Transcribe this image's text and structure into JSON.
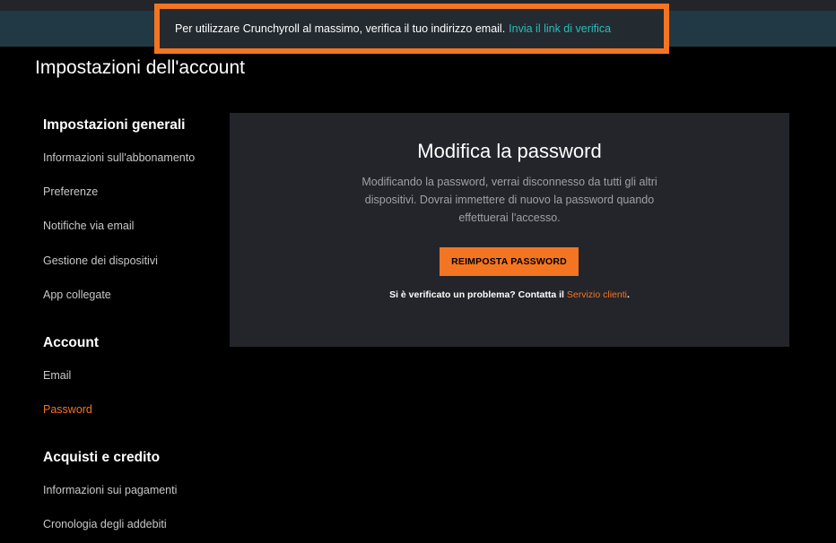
{
  "banner": {
    "message": "Per utilizzare Crunchyroll al massimo, verifica il tuo indirizzo email.",
    "link": "Invia il link di verifica"
  },
  "page_title": "Impostazioni dell'account",
  "sidebar": {
    "sections": [
      {
        "title": "Impostazioni generali",
        "items": [
          "Informazioni sull'abbonamento",
          "Preferenze",
          "Notifiche via email",
          "Gestione dei dispositivi",
          "App collegate"
        ]
      },
      {
        "title": "Account",
        "items": [
          "Email",
          "Password"
        ]
      },
      {
        "title": "Acquisti e credito",
        "items": [
          "Informazioni sui pagamenti",
          "Cronologia degli addebiti"
        ]
      }
    ],
    "active_item": "Password"
  },
  "card": {
    "title": "Modifica la password",
    "description": "Modificando la password, verrai disconnesso da tutti gli altri dispositivi. Dovrai immettere di nuovo la password quando effettuerai l'accesso.",
    "button_label": "REIMPOSTA PASSWORD",
    "problem_text": "Si è verificato un problema? Contatta il",
    "problem_link": "Servizio clienti",
    "problem_end": "."
  },
  "colors": {
    "accent": "#f47521",
    "link_teal": "#2abdbb",
    "card_bg": "#23252b",
    "banner_bg": "#213944"
  }
}
